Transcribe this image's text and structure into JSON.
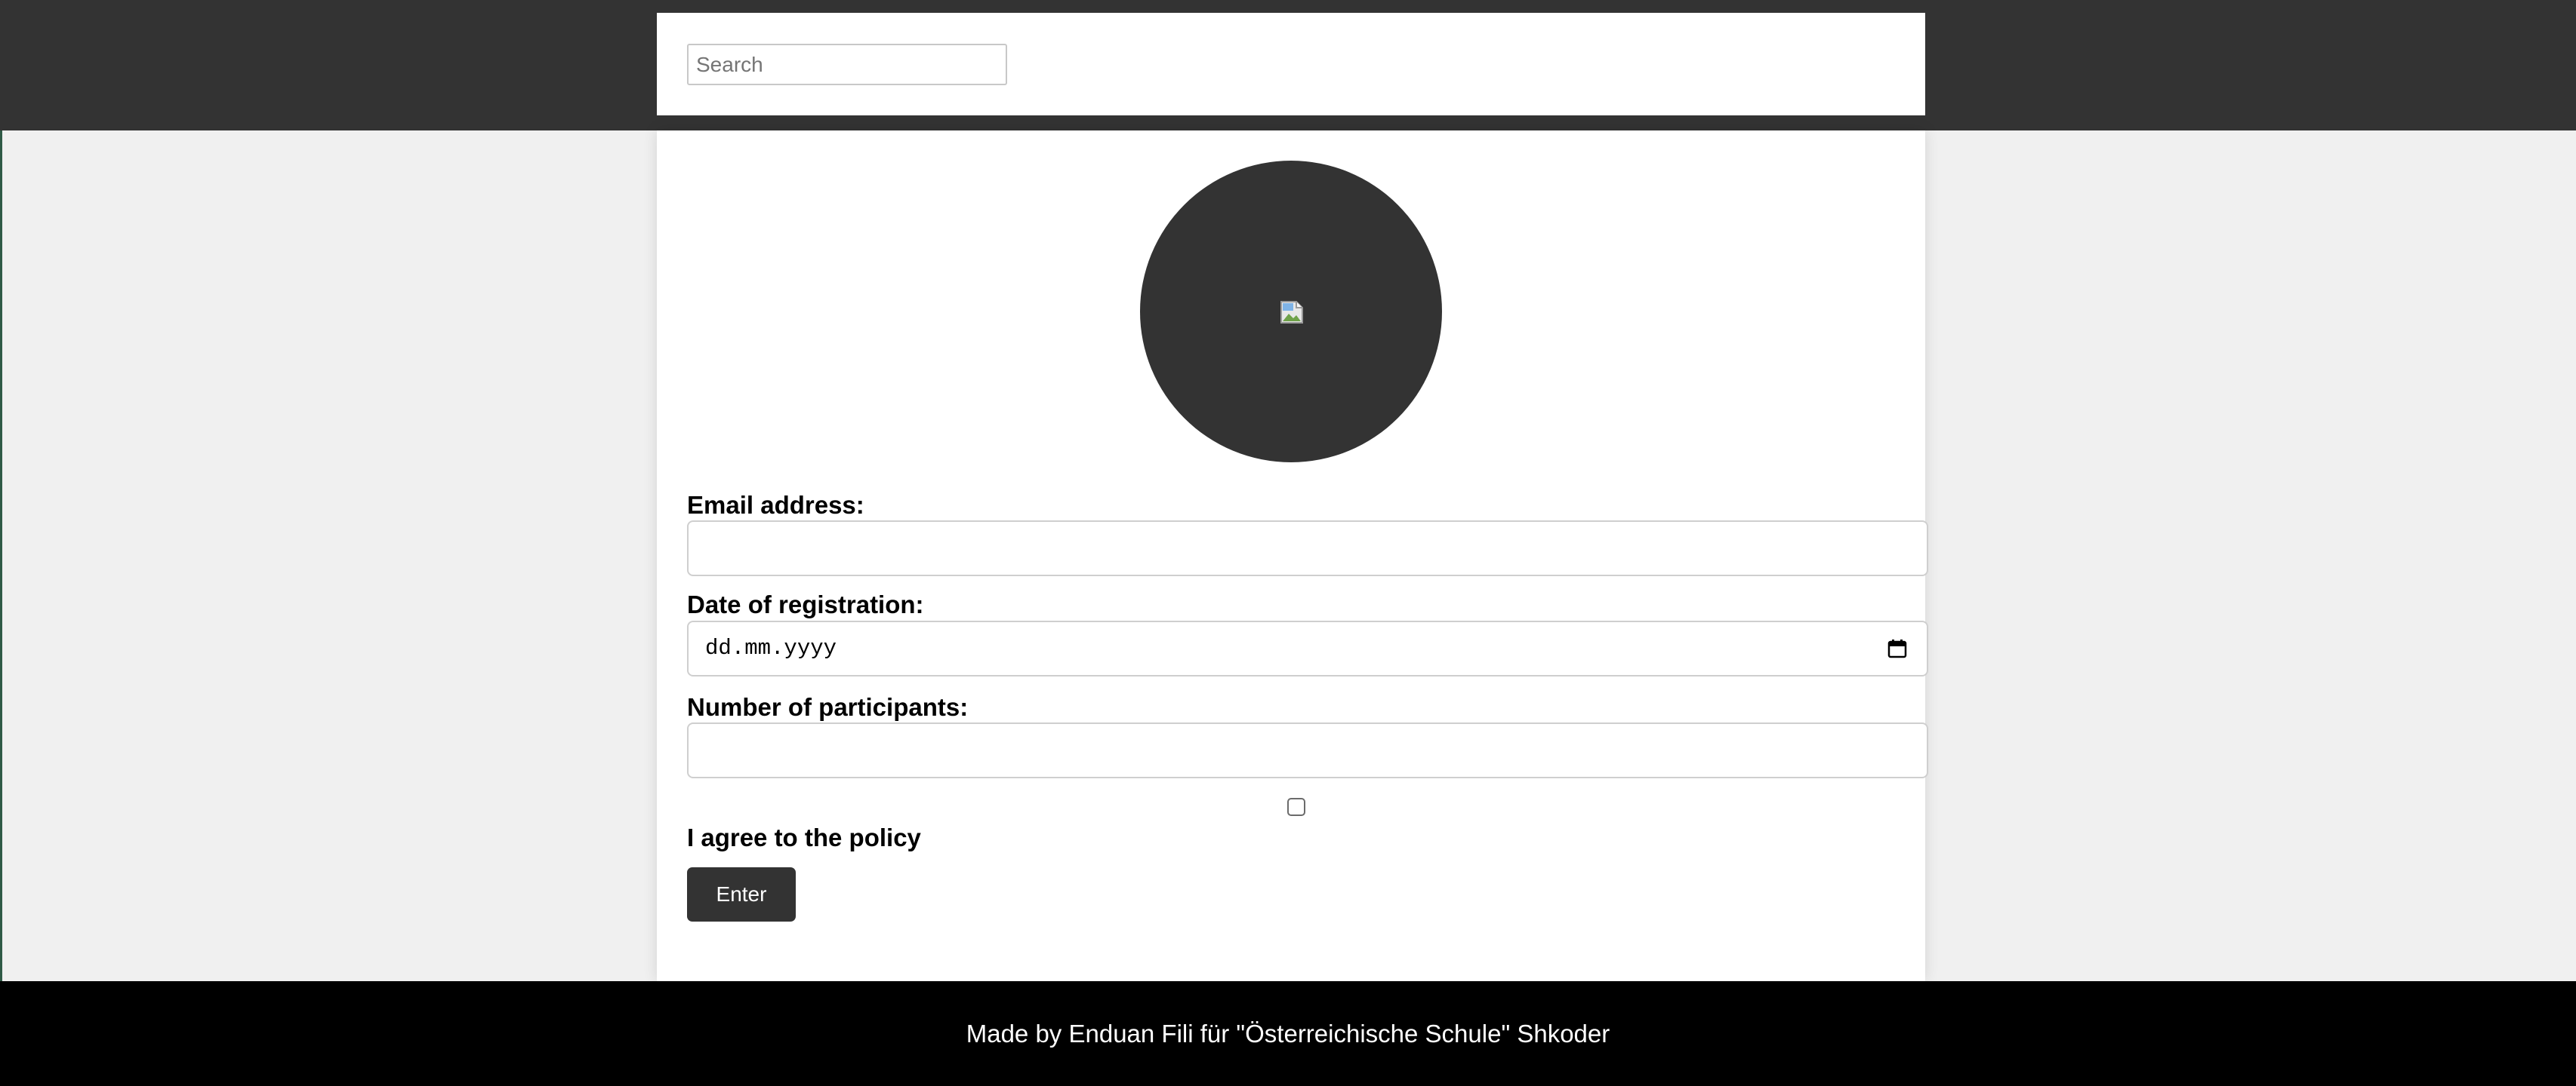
{
  "header": {
    "search": {
      "placeholder": "Search",
      "value": ""
    }
  },
  "profile": {
    "avatar_icon": "broken-image-icon"
  },
  "form": {
    "email": {
      "label": "Email address:",
      "value": ""
    },
    "date": {
      "label": "Date of registration:",
      "placeholder": "dd.mm.yyyy",
      "icon": "calendar-icon"
    },
    "participants": {
      "label": "Number of participants:",
      "value": ""
    },
    "policy": {
      "label": "I agree to the policy",
      "checked": false
    },
    "submit_label": "Enter"
  },
  "footer": {
    "text": "Made by Enduan Fili für \"Österreichische Schule\" Shkoder"
  },
  "colors": {
    "dark": "#333333",
    "page_background": "#f0f0f0",
    "footer_background": "#000000",
    "card_background": "#ffffff"
  }
}
